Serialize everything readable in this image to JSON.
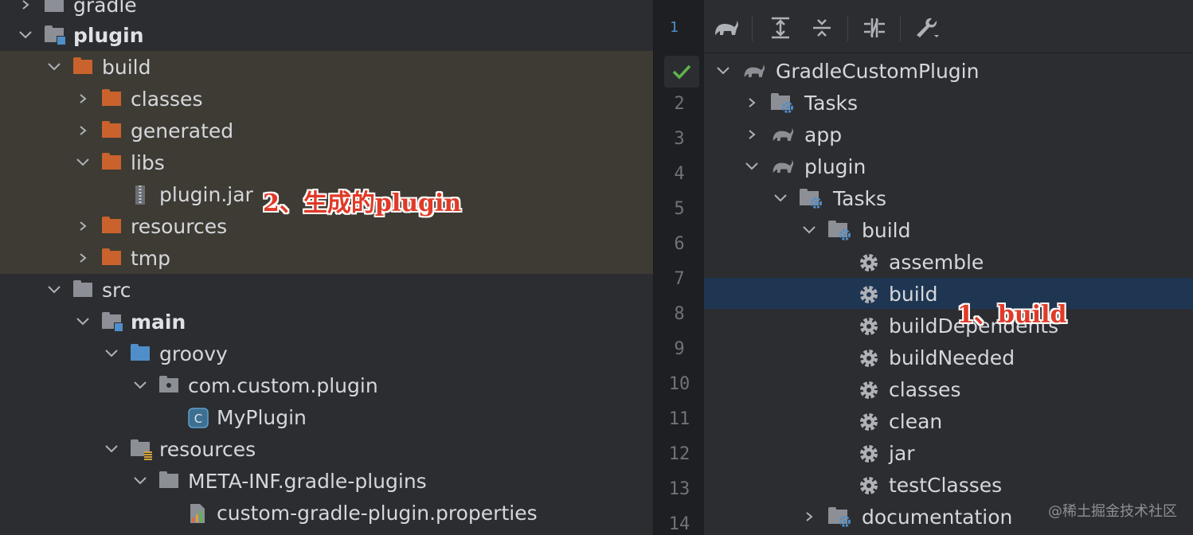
{
  "project_tree": {
    "items": [
      {
        "label": "gradle"
      },
      {
        "label": "plugin"
      },
      {
        "label": "build"
      },
      {
        "label": "classes"
      },
      {
        "label": "generated"
      },
      {
        "label": "libs"
      },
      {
        "label": "plugin.jar"
      },
      {
        "label": "resources"
      },
      {
        "label": "tmp"
      },
      {
        "label": "src"
      },
      {
        "label": "main"
      },
      {
        "label": "groovy"
      },
      {
        "label": "com.custom.plugin"
      },
      {
        "label": "MyPlugin"
      },
      {
        "label": "resources"
      },
      {
        "label": "META-INF.gradle-plugins"
      },
      {
        "label": "custom-gradle-plugin.properties"
      }
    ]
  },
  "annotations": {
    "generated_plugin": "2、生成的plugin",
    "build": "1、build"
  },
  "gutter": {
    "top_marker": "1",
    "lines": [
      "2",
      "3",
      "4",
      "5",
      "6",
      "7",
      "8",
      "9",
      "10",
      "11",
      "12",
      "13",
      "14"
    ]
  },
  "gradle_panel": {
    "items": [
      {
        "label": "GradleCustomPlugin"
      },
      {
        "label": "Tasks"
      },
      {
        "label": "app"
      },
      {
        "label": "plugin"
      },
      {
        "label": "Tasks"
      },
      {
        "label": "build"
      },
      {
        "label": "assemble"
      },
      {
        "label": "build"
      },
      {
        "label": "buildDependents"
      },
      {
        "label": "buildNeeded"
      },
      {
        "label": "classes"
      },
      {
        "label": "clean"
      },
      {
        "label": "jar"
      },
      {
        "label": "testClasses"
      },
      {
        "label": "documentation"
      }
    ]
  },
  "watermark": "@稀土掘金技术社区",
  "colors": {
    "background": "#2b2d30",
    "build_highlight": "#3d3b33",
    "selection": "#1f3652",
    "excluded_folder": "#c9622d",
    "folder": "#8c8f95",
    "source_folder": "#4f8ec9",
    "annotation": "#e03a28",
    "check": "#5fb34b"
  }
}
